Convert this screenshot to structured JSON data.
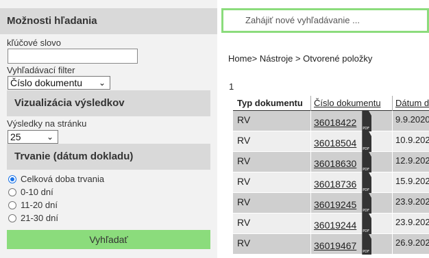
{
  "sidebar": {
    "title": "Možnosti hľadania",
    "keyword_label": "kľúčové slovo",
    "keyword_value": "",
    "filter_label": "Vyhľadávací filter",
    "filter_selected": "Číslo dokumentu",
    "visualization_title": "Vizualizácia výsledkov",
    "per_page_label": "Výsledky na stránku",
    "per_page_selected": "25",
    "duration_title": "Trvanie (dátum dokladu)",
    "duration_options": [
      {
        "label": "Celková doba trvania",
        "checked": true
      },
      {
        "label": "0-10 dní",
        "checked": false
      },
      {
        "label": "11-20 dní",
        "checked": false
      },
      {
        "label": "21-30 dní",
        "checked": false
      }
    ],
    "search_button": "Vyhľadať"
  },
  "main": {
    "new_search": "Zahájiť nové vyhľadávanie ...",
    "breadcrumb_home": "Home>",
    "breadcrumb_tools": "Nástroje",
    "breadcrumb_current": "> Otvorené položky",
    "page_number": "1",
    "table": {
      "headers": [
        "Typ dokumentu",
        "Číslo dokumentu",
        "Dátum d"
      ],
      "rows": [
        {
          "type": "RV",
          "number": "36018422",
          "date": "9.9.2020"
        },
        {
          "type": "RV",
          "number": "36018504",
          "date": "10.9.202"
        },
        {
          "type": "RV",
          "number": "36018630",
          "date": "12.9.202"
        },
        {
          "type": "RV",
          "number": "36018736",
          "date": "15.9.202"
        },
        {
          "type": "RV",
          "number": "36019245",
          "date": "23.9.202"
        },
        {
          "type": "RV",
          "number": "36019244",
          "date": "23.9.202"
        },
        {
          "type": "RV",
          "number": "36019467",
          "date": "26.9.202"
        }
      ]
    }
  },
  "colors": {
    "accent_green": "#8bdc7c",
    "radio_blue": "#1a73e8"
  }
}
